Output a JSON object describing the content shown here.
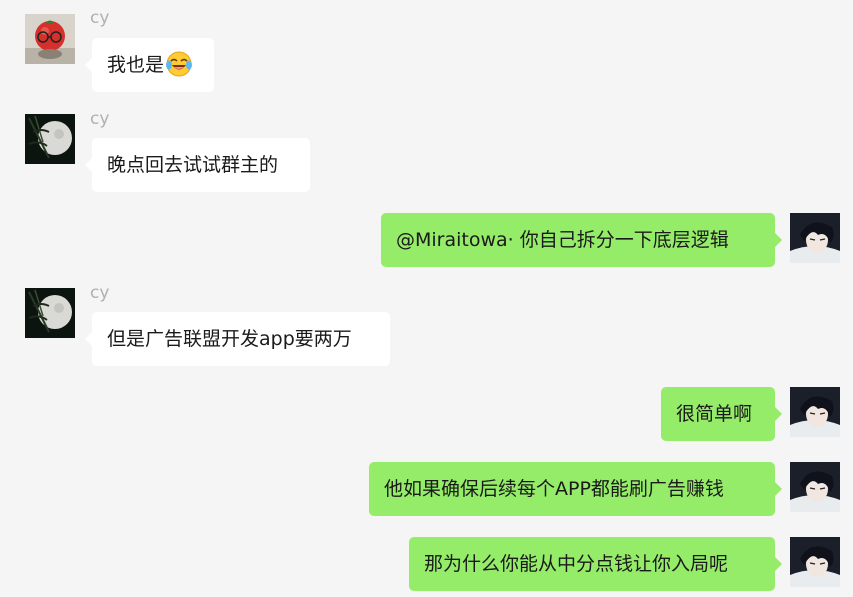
{
  "messages": [
    {
      "sender": "cy",
      "side": "in",
      "text": "我也是",
      "emoji": "laughing-crying-emoji"
    },
    {
      "sender": "cy",
      "side": "in",
      "text": "晚点回去试试群主的"
    },
    {
      "sender": "me",
      "side": "out",
      "text": "@Miraitowa· 你自己拆分一下底层逻辑"
    },
    {
      "sender": "cy",
      "side": "in",
      "text": "但是广告联盟开发app要两万"
    },
    {
      "sender": "me",
      "side": "out",
      "text": "很简单啊"
    },
    {
      "sender": "me",
      "side": "out",
      "text": "他如果确保后续每个APP都能刷广告赚钱"
    },
    {
      "sender": "me",
      "side": "out",
      "text": "那为什么你能从中分点钱让你入局呢"
    }
  ],
  "colors": {
    "background": "#f5f5f5",
    "incoming_bubble": "#ffffff",
    "outgoing_bubble": "#95ec69",
    "sender_name": "#b0b0b0"
  },
  "icons": {
    "avatar_cy_1": "red-tomato-avatar",
    "avatar_cy_2": "moon-bamboo-avatar",
    "avatar_me": "anime-boy-avatar"
  }
}
